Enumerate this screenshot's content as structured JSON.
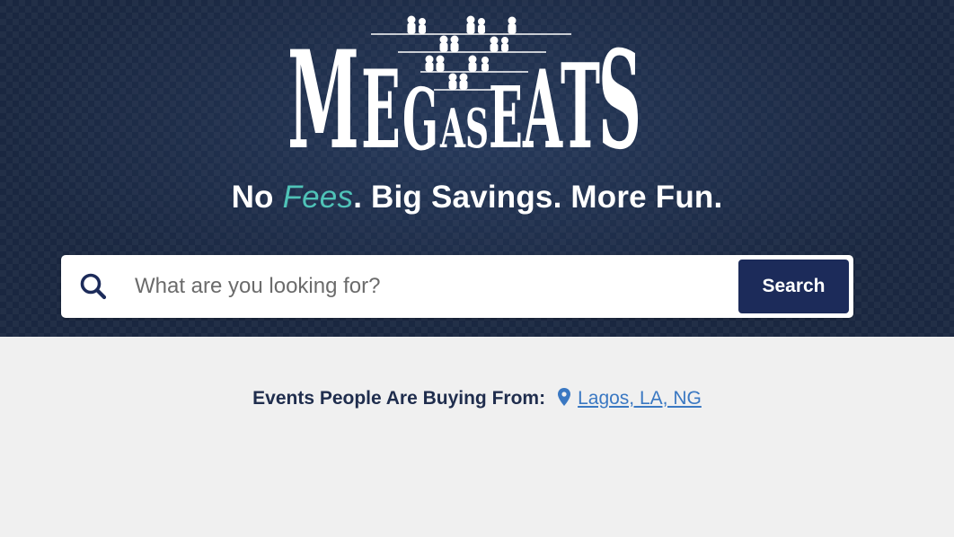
{
  "brand": {
    "logo_text": "MEGASEATS",
    "logo_icon": "audience-silhouette-icon"
  },
  "hero": {
    "tagline_prefix": "No ",
    "tagline_accent": "Fees",
    "tagline_suffix": ". Big Savings. More Fun.",
    "accent_color": "#4fc3b8"
  },
  "search": {
    "placeholder": "What are you looking for?",
    "value": "",
    "button_label": "Search",
    "icon": "search-icon",
    "button_color": "#1c2b5a"
  },
  "location": {
    "label": "Events People Are Buying From:",
    "icon": "map-pin-icon",
    "value": "Lagos, LA, NG",
    "link_color": "#3a78c2"
  }
}
